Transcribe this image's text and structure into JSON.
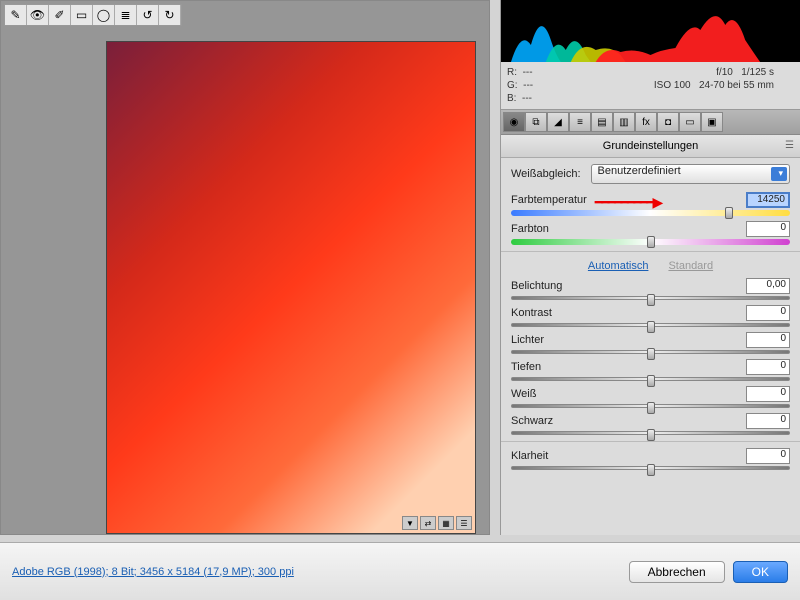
{
  "toolbar_icons": [
    "crop",
    "eye",
    "brush",
    "rect",
    "oval",
    "list",
    "rotate-left",
    "rotate-right"
  ],
  "meta": {
    "r": "R:",
    "r_val": "---",
    "g": "G:",
    "g_val": "---",
    "b": "B:",
    "b_val": "---",
    "aperture": "f/10",
    "shutter": "1/125 s",
    "iso": "ISO 100",
    "lens": "24-70 bei 55 mm"
  },
  "panel_title": "Grundeinstellungen",
  "wb": {
    "label": "Weißabgleich:",
    "value": "Benutzerdefiniert"
  },
  "sliders": {
    "temp": {
      "label": "Farbtemperatur",
      "value": "14250",
      "pos": 78
    },
    "tint": {
      "label": "Farbton",
      "value": "0",
      "pos": 50
    },
    "exposure": {
      "label": "Belichtung",
      "value": "0,00",
      "pos": 50
    },
    "contrast": {
      "label": "Kontrast",
      "value": "0",
      "pos": 50
    },
    "highlights": {
      "label": "Lichter",
      "value": "0",
      "pos": 50
    },
    "shadows": {
      "label": "Tiefen",
      "value": "0",
      "pos": 50
    },
    "whites": {
      "label": "Weiß",
      "value": "0",
      "pos": 50
    },
    "blacks": {
      "label": "Schwarz",
      "value": "0",
      "pos": 50
    },
    "clarity": {
      "label": "Klarheit",
      "value": "0",
      "pos": 50
    }
  },
  "links": {
    "auto": "Automatisch",
    "standard": "Standard"
  },
  "footer": {
    "info": "Adobe RGB (1998); 8 Bit; 3456 x 5184 (17,9 MP); 300 ppi",
    "cancel": "Abbrechen",
    "ok": "OK"
  }
}
